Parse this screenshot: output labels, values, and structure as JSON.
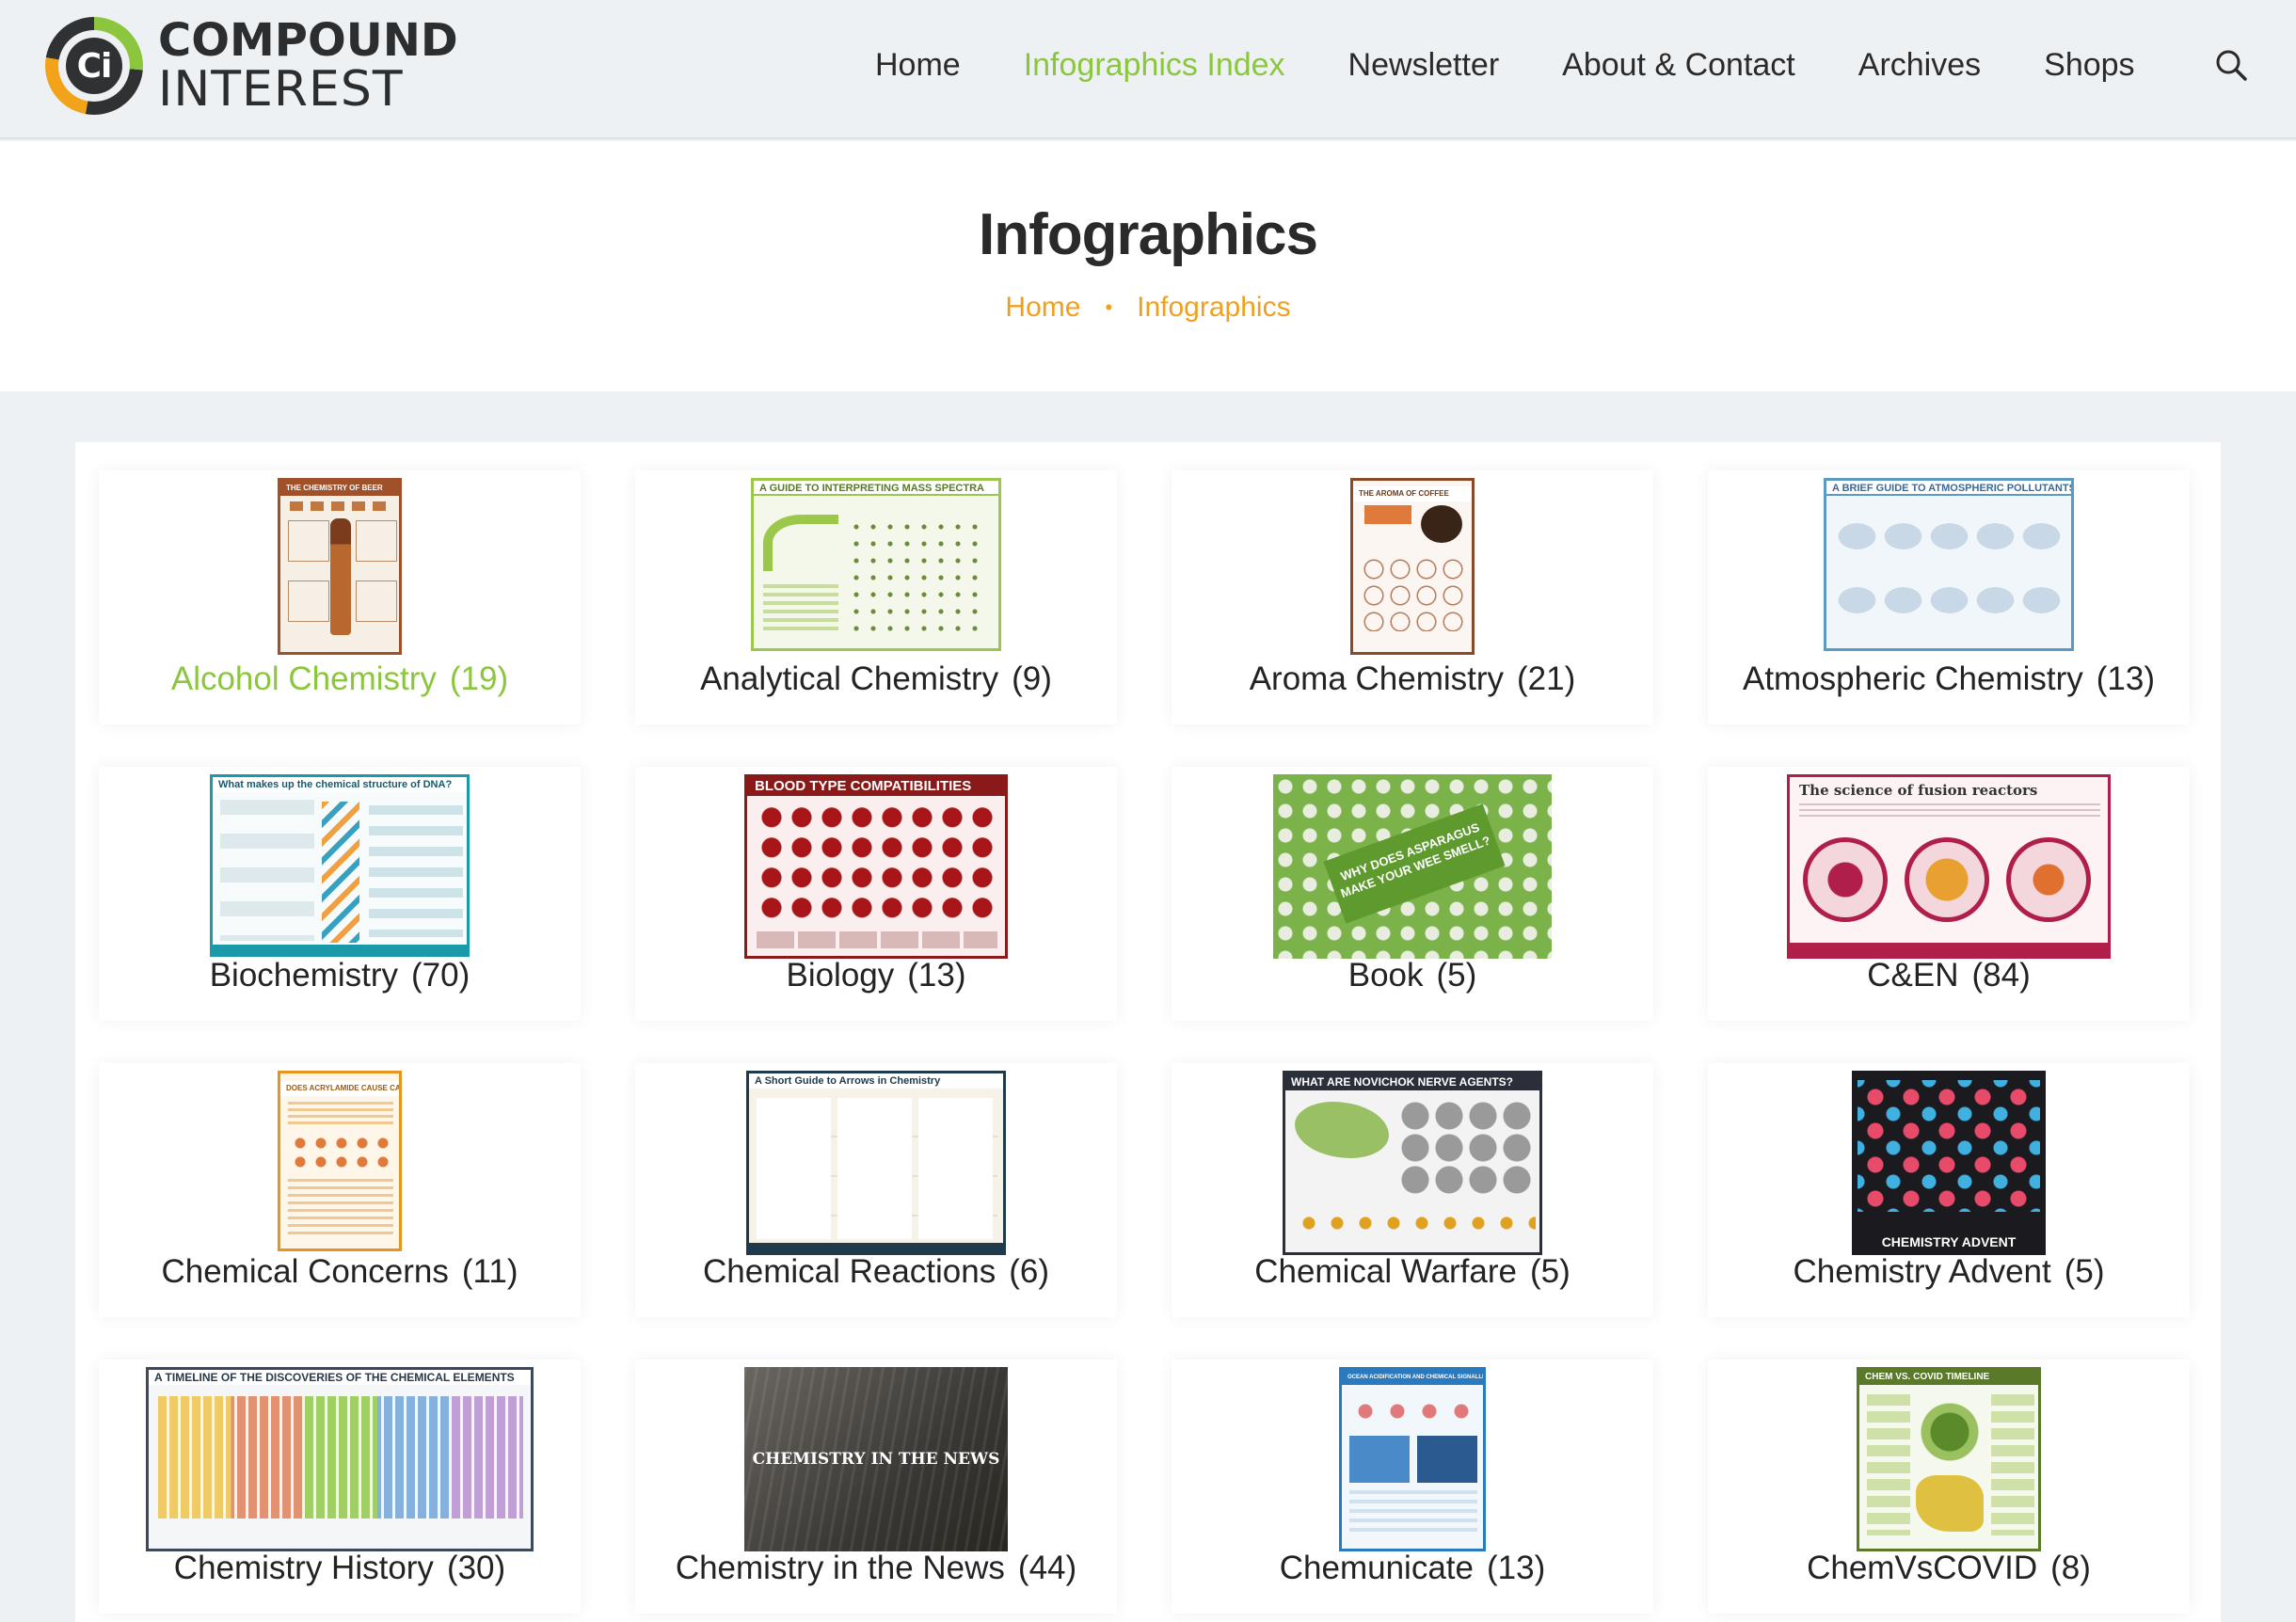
{
  "header": {
    "logo": {
      "line1": "COMPOUND",
      "line2": "INTEREST",
      "mark": "Ci"
    },
    "nav": [
      {
        "label": "Home",
        "active": false
      },
      {
        "label": "Infographics Index",
        "active": true
      },
      {
        "label": "Newsletter",
        "active": false
      },
      {
        "label": "About & Contact",
        "active": false
      },
      {
        "label": "Archives",
        "active": false
      },
      {
        "label": "Shops",
        "active": false
      }
    ],
    "search_icon": "search-icon"
  },
  "page": {
    "title": "Infographics",
    "breadcrumb": [
      "Home",
      "Infographics"
    ]
  },
  "thumb_text": {
    "beer": "THE CHEMISTRY OF BEER",
    "mass": "A GUIDE TO INTERPRETING MASS SPECTRA",
    "aroma": "THE AROMA OF COFFEE",
    "atmos": "A BRIEF GUIDE TO ATMOSPHERIC POLLUTANTS",
    "dna": "What makes up the chemical structure of DNA?",
    "blood": "BLOOD TYPE COMPATIBILITIES",
    "book": "WHY DOES ASPARAGUS MAKE YOUR WEE SMELL?",
    "fusion": "The science of fusion reactors",
    "acryl": "DOES ACRYLAMIDE CAUSE CANCER?",
    "arrows": "A Short Guide to Arrows in Chemistry",
    "novichok": "WHAT ARE NOVICHOK NERVE AGENTS?",
    "advent": "CHEMISTRY ADVENT",
    "timeline": "A TIMELINE OF THE DISCOVERIES OF THE CHEMICAL ELEMENTS",
    "news": "CHEMISTRY IN THE NEWS",
    "chemun": "OCEAN ACIDIFICATION AND CHEMICAL SIGNALLING",
    "covid": "CHEM VS. COVID TIMELINE"
  },
  "categories": [
    {
      "name": "Alcohol Chemistry",
      "count": "(19)",
      "active": true
    },
    {
      "name": "Analytical Chemistry",
      "count": "(9)"
    },
    {
      "name": "Aroma Chemistry",
      "count": "(21)"
    },
    {
      "name": "Atmospheric Chemistry",
      "count": "(13)"
    },
    {
      "name": "Biochemistry",
      "count": "(70)"
    },
    {
      "name": "Biology",
      "count": "(13)"
    },
    {
      "name": "Book",
      "count": "(5)"
    },
    {
      "name": "C&EN",
      "count": "(84)"
    },
    {
      "name": "Chemical Concerns",
      "count": "(11)"
    },
    {
      "name": "Chemical Reactions",
      "count": "(6)"
    },
    {
      "name": "Chemical Warfare",
      "count": "(5)"
    },
    {
      "name": "Chemistry Advent",
      "count": "(5)"
    },
    {
      "name": "Chemistry History",
      "count": "(30)"
    },
    {
      "name": "Chemistry in the News",
      "count": "(44)"
    },
    {
      "name": "Chemunicate",
      "count": "(13)"
    },
    {
      "name": "ChemVsCOVID",
      "count": "(8)"
    }
  ],
  "colors": {
    "accent_green": "#8cc63f",
    "accent_orange": "#f0a020",
    "text_dark": "#232323"
  }
}
